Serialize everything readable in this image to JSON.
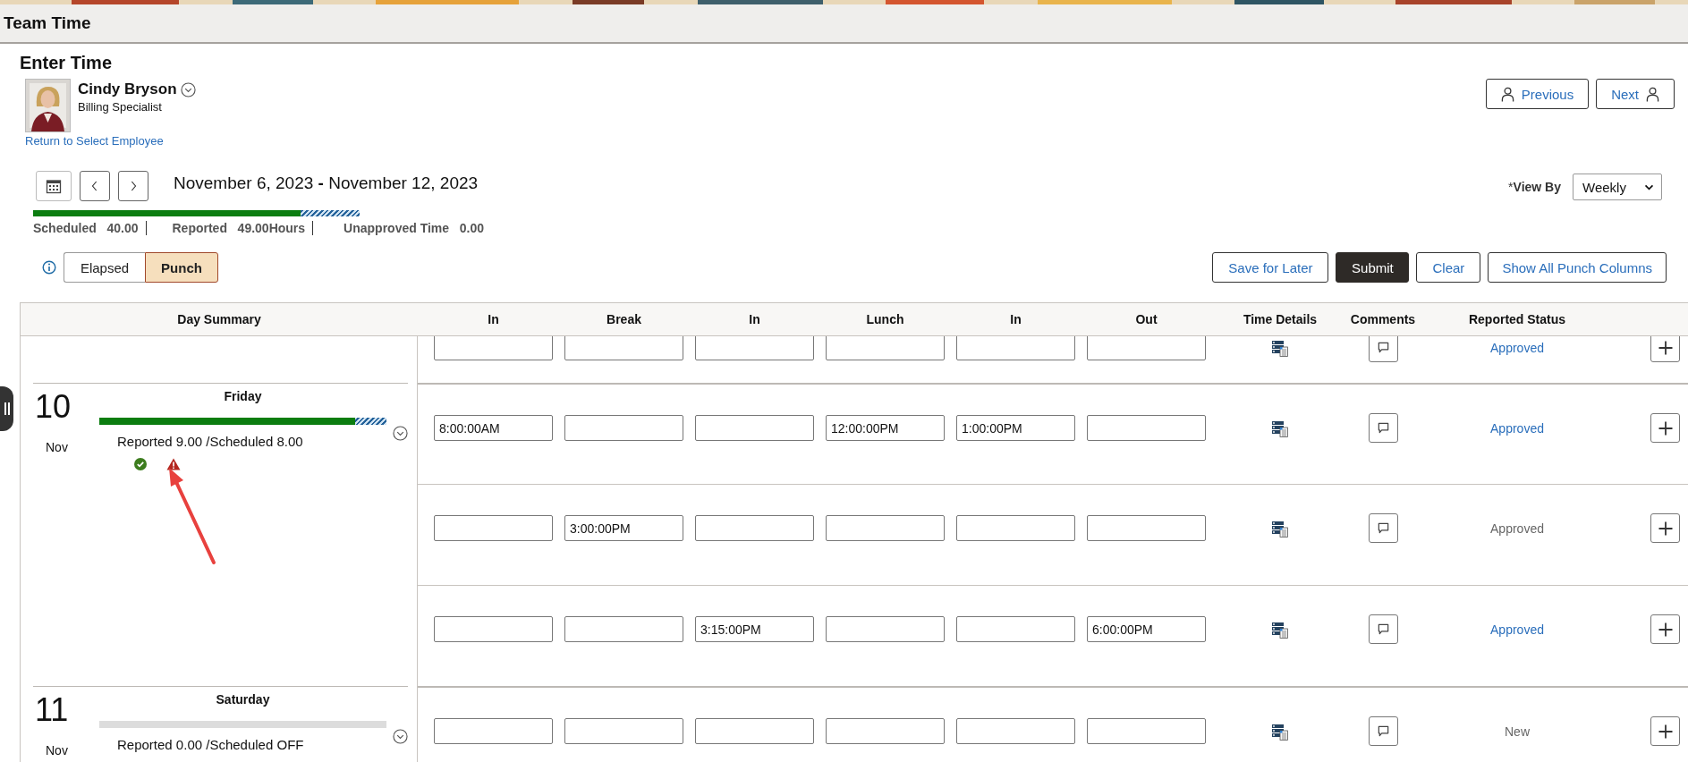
{
  "app_title": "Team Time",
  "page_title": "Enter Time",
  "employee": {
    "name": "Cindy Bryson",
    "job_title": "Billing Specialist",
    "return_link": "Return to Select Employee"
  },
  "employee_nav": [
    {
      "label": "Previous",
      "kind": "previous"
    },
    {
      "label": "Next",
      "kind": "next"
    }
  ],
  "period": {
    "label": "November 6, 2023 **-** November 12, 2023",
    "level": 0.82,
    "over": true
  },
  "totals": [
    {
      "label": "Scheduled",
      "value": "40.00",
      "separator": true
    },
    {
      "label": "Reported",
      "value": "49.00Hours",
      "separator": true
    },
    {
      "label": "Unapproved Time",
      "value": "0.00",
      "separator": false
    }
  ],
  "view_by": {
    "required_mark": "*",
    "label": "View By",
    "value": "Weekly"
  },
  "entry_modes": [
    {
      "label": "Elapsed",
      "selected": false
    },
    {
      "label": "Punch",
      "selected": true
    }
  ],
  "actions": [
    {
      "label": "Save for Later",
      "primary": false
    },
    {
      "label": "Submit",
      "primary": true
    },
    {
      "label": "Clear",
      "primary": false
    },
    {
      "label": "Show All Punch Columns",
      "primary": false
    }
  ],
  "table": {
    "columns": [
      "Day Summary",
      "In",
      "Break",
      "In",
      "Lunch",
      "In",
      "Out",
      "Time Details",
      "Comments",
      "Reported Status"
    ],
    "days": [
      {
        "rows": [
          {
            "status": "Approved",
            "status_link": true
          }
        ]
      },
      {
        "date": "10",
        "month": "Nov",
        "weekday": "Friday",
        "level": 0.89,
        "over": true,
        "summary": "Reported 9.00 /Scheduled 8.00",
        "indicators": [
          {
            "kind": "check"
          },
          {
            "kind": "warning"
          }
        ],
        "annotation_arrow": true,
        "rows": [
          {
            "punches": {
              "in_1": "8:00:00AM",
              "lunch": "12:00:00PM",
              "in_3": "1:00:00PM"
            },
            "status": "Approved",
            "status_link": true
          },
          {
            "punches": {
              "break": "3:00:00PM"
            },
            "status": "Approved",
            "status_link": false
          },
          {
            "punches": {
              "in_2": "3:15:00PM",
              "out": "6:00:00PM"
            },
            "status": "Approved",
            "status_link": true
          }
        ]
      },
      {
        "date": "11",
        "month": "Nov",
        "weekday": "Saturday",
        "level": 0,
        "over": false,
        "summary": "Reported 0.00 /Scheduled OFF",
        "rows": [
          {
            "status": "New",
            "status_link": false
          }
        ]
      }
    ]
  }
}
